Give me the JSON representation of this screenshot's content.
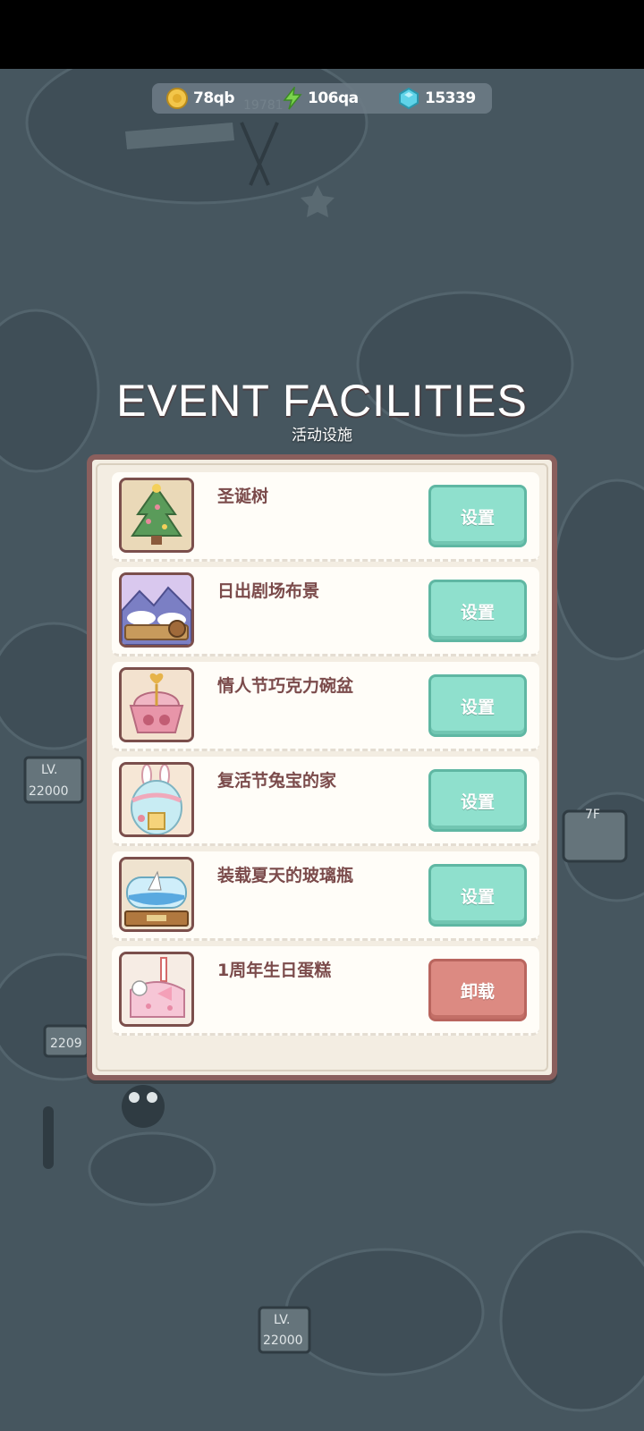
{
  "resources": {
    "coins": {
      "icon": "coin-icon",
      "value": "78qb"
    },
    "energy": {
      "icon": "lightning-icon",
      "value": "106qa"
    },
    "gems": {
      "icon": "gem-icon",
      "value": "15339"
    }
  },
  "title": {
    "main": "EVENT FACILITIES",
    "sub": "活动设施"
  },
  "scene_signs": {
    "top": "19781",
    "left": "22000",
    "lower_left": "2209",
    "bottom": "22000",
    "level_label": "LV.",
    "sign_7f": "7F"
  },
  "facilities": [
    {
      "name": "圣诞树",
      "icon": "christmas-tree-icon",
      "button": "设置",
      "button_type": "set"
    },
    {
      "name": "日出剧场布景",
      "icon": "sunrise-stage-icon",
      "button": "设置",
      "button_type": "set"
    },
    {
      "name": "情人节巧克力碗盆",
      "icon": "chocolate-bowl-icon",
      "button": "设置",
      "button_type": "set"
    },
    {
      "name": "复活节兔宝的家",
      "icon": "easter-bunny-house-icon",
      "button": "设置",
      "button_type": "set"
    },
    {
      "name": "装载夏天的玻璃瓶",
      "icon": "summer-bottle-icon",
      "button": "设置",
      "button_type": "set"
    },
    {
      "name": "1周年生日蛋糕",
      "icon": "birthday-cake-icon",
      "button": "卸载",
      "button_type": "unload"
    }
  ],
  "colors": {
    "background": "#46565f",
    "panel": "#f3ede2",
    "panel_border": "#8a5f5d",
    "set_button": "#8fe0cd",
    "unload_button": "#dc8a82",
    "label_text": "#7b4b4b"
  }
}
